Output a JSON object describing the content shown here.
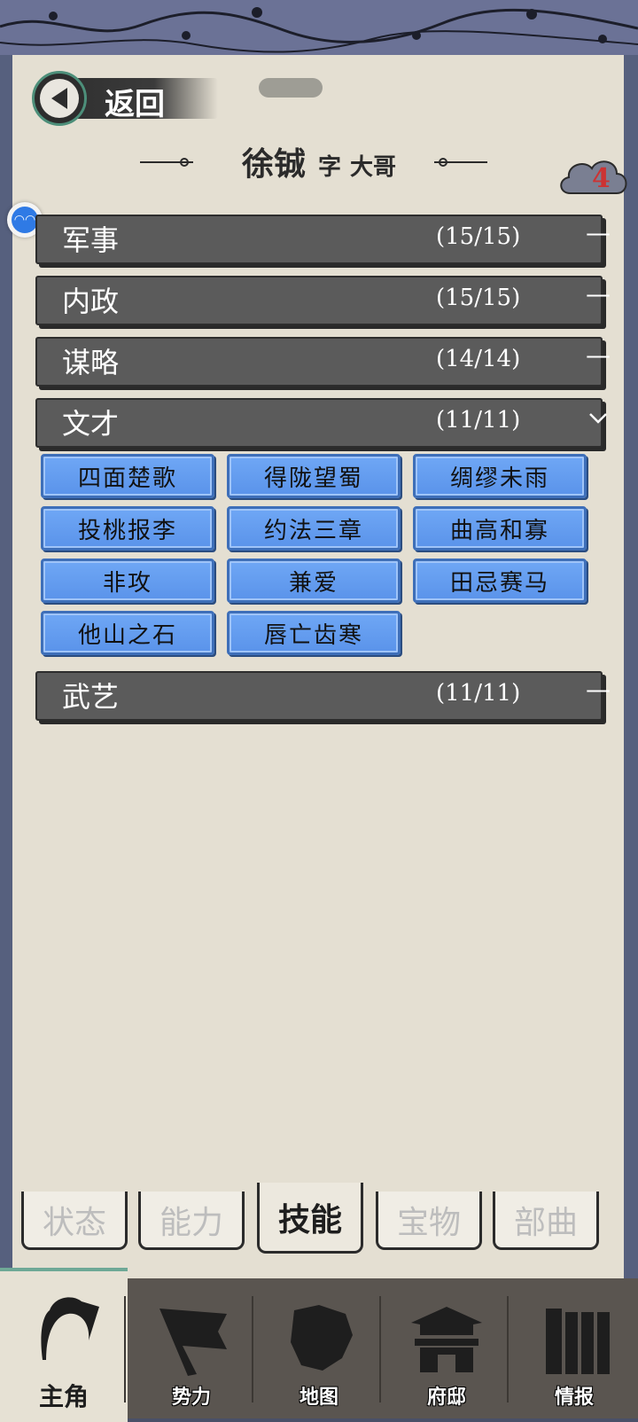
{
  "header": {
    "back_label": "返回",
    "name": "徐铖",
    "zi_label": "字",
    "courtesy_name": "大哥",
    "badge_count": "4"
  },
  "categories": [
    {
      "label": "军事",
      "count": "(15/15)",
      "state": "collapsed"
    },
    {
      "label": "内政",
      "count": "(15/15)",
      "state": "collapsed"
    },
    {
      "label": "谋略",
      "count": "(14/14)",
      "state": "collapsed"
    },
    {
      "label": "文才",
      "count": "(11/11)",
      "state": "expanded"
    },
    {
      "label": "武艺",
      "count": "(11/11)",
      "state": "collapsed"
    }
  ],
  "skills": [
    "四面楚歌",
    "得陇望蜀",
    "绸缪未雨",
    "投桃报李",
    "约法三章",
    "曲高和寡",
    "非攻",
    "兼爱",
    "田忌赛马",
    "他山之石",
    "唇亡齿寒"
  ],
  "tabs": [
    {
      "label": "状态",
      "active": false
    },
    {
      "label": "能力",
      "active": false
    },
    {
      "label": "技能",
      "active": true
    },
    {
      "label": "宝物",
      "active": false
    },
    {
      "label": "部曲",
      "active": false
    }
  ],
  "nav": [
    {
      "label": "主角",
      "icon": "hero-icon",
      "active": true
    },
    {
      "label": "势力",
      "icon": "flag-icon",
      "active": false
    },
    {
      "label": "地图",
      "icon": "map-icon",
      "active": false
    },
    {
      "label": "府邸",
      "icon": "mansion-icon",
      "active": false
    },
    {
      "label": "情报",
      "icon": "scroll-icon",
      "active": false
    }
  ],
  "colors": {
    "category_bar": "#5b5b5b",
    "skill_button": "#6fa7f5",
    "badge_text": "#cc3333",
    "paper": "#e4dfd2"
  }
}
